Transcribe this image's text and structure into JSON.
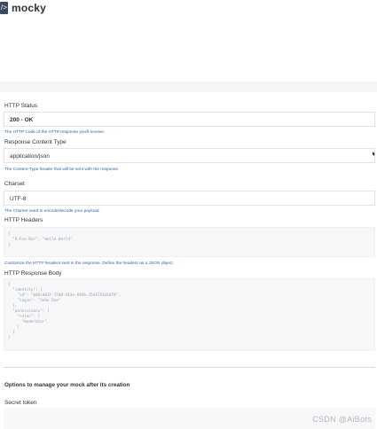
{
  "header": {
    "logo_glyph": "/>",
    "brand": "mocky"
  },
  "http_status": {
    "label": "HTTP Status",
    "value": "200 - OK",
    "help": "The HTTP Code of the HTTP response you'll receive."
  },
  "content_type": {
    "label": "Response Content Type",
    "value": "application/json",
    "help": "The Content-Type header that will be sent with the response."
  },
  "charset": {
    "label": "Charset",
    "value": "UTF-8",
    "help": "The Charset used to encode/decode your payload."
  },
  "headers": {
    "label": "HTTP Headers",
    "code": "{\n  \"X-Foo-Bar\": \"Hello World\"\n}",
    "help": "Customize the HTTP headers sent in the response. Define the headers as a JSON object."
  },
  "body": {
    "label": "HTTP Response Body",
    "code": "{\n  \"identity\": {\n    \"id\": \"b06cd03f-75d0-413a-b94b-35e155444d70\",\n    \"login\": \"John Doe\"\n  },\n  \"permissions\": {\n    \"roles\": [\n      \"moderator\"\n    ]\n  }\n}"
  },
  "options": {
    "title": "Options to manage your mock after its creation"
  },
  "secret": {
    "label": "Secret token"
  },
  "watermark": "CSDN @AiBots"
}
